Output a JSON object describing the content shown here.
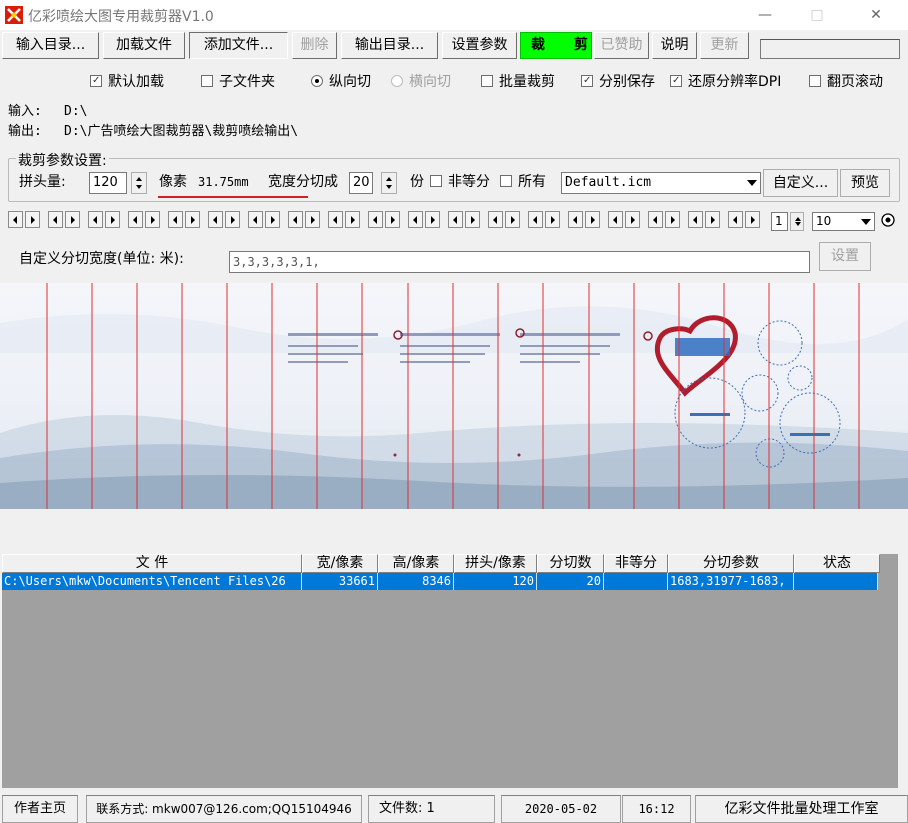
{
  "window": {
    "title": "亿彩喷绘大图专用裁剪器V1.0",
    "minimize": "—",
    "maximize": "□",
    "close": "✕"
  },
  "toolbar": {
    "input_dir": "输入目录...",
    "load_file": "加载文件",
    "add_file": "添加文件...",
    "delete": "删除",
    "output_dir": "输出目录...",
    "settings": "设置参数",
    "crop": "裁 剪",
    "donated": "已赞助",
    "help": "说明",
    "update": "更新"
  },
  "options": {
    "default_load": {
      "label": "默认加载",
      "checked": true
    },
    "subfolder": {
      "label": "子文件夹",
      "checked": false
    },
    "vertical_cut": {
      "label": "纵向切",
      "selected": true
    },
    "horizontal_cut": {
      "label": "横向切",
      "selected": false
    },
    "batch_crop": {
      "label": "批量裁剪",
      "checked": false
    },
    "save_separately": {
      "label": "分别保存",
      "checked": true
    },
    "restore_dpi": {
      "label": "还原分辨率DPI",
      "checked": true
    },
    "page_scroll": {
      "label": "翻页滚动",
      "checked": false
    }
  },
  "paths": {
    "input_label": "输入:",
    "input_value": "D:\\",
    "output_label": "输出:",
    "output_value": "D:\\广告喷绘大图裁剪器\\裁剪喷绘输出\\"
  },
  "crop_params": {
    "group_title": "裁剪参数设置:",
    "overlap_label": "拼头量:",
    "overlap_value": "120",
    "unit_pixel": "像素",
    "mm_value": "31.75mm",
    "width_split_label": "宽度分切成",
    "split_count": "20",
    "parts_label": "份",
    "unequal_label": "非等分",
    "all_label": "所有",
    "icm_value": "Default.icm",
    "customize": "自定义...",
    "preview": "预览"
  },
  "scroller": {
    "page_value": "1",
    "count_value": "10"
  },
  "custom_width": {
    "label": "自定义分切宽度(单位: 米):",
    "value": "3,3,3,3,3,1,",
    "set_button": "设置"
  },
  "table": {
    "columns": [
      "文  件",
      "宽/像素",
      "高/像素",
      "拼头/像素",
      "分切数",
      "非等分",
      "分切参数",
      "状态"
    ],
    "rows": [
      [
        "C:\\Users\\mkw\\Documents\\Tencent Files\\26",
        "33661",
        "8346",
        "120",
        "20",
        "",
        "1683,31977-1683,",
        ""
      ]
    ]
  },
  "statusbar": {
    "author_home": "作者主页",
    "contact": "联系方式: mkw007@126.com;QQ15104946",
    "file_count": "文件数: 1",
    "date": "2020-05-02",
    "time": "16:12",
    "studio": "亿彩文件批量处理工作室"
  },
  "colors": {
    "crop_button": "#00ff00",
    "selection": "#0078d7",
    "cut_line": "#e03030",
    "heart": "#b01e2e",
    "stamp_blue": "#3b6fb6"
  }
}
